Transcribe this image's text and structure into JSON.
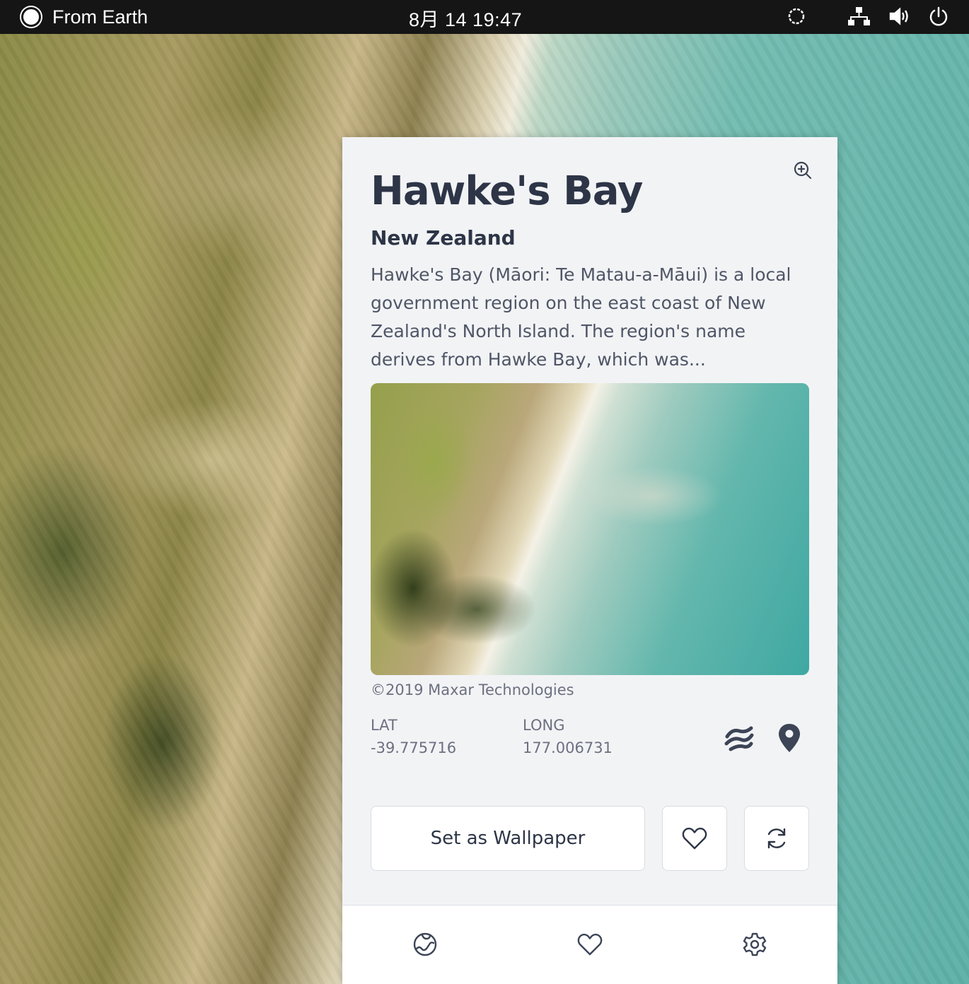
{
  "topbar": {
    "app_name": "From Earth",
    "clock": "8月 14  19:47",
    "icons": [
      "app-indicator-icon",
      "circle-status-icon",
      "network-icon",
      "volume-icon",
      "power-icon"
    ]
  },
  "location": {
    "name": "Hawke's Bay",
    "country": "New Zealand",
    "description": "Hawke's Bay (Māori: Te Matau-a-Māui) is a local government region on the east coast of New Zealand's North Island. The region's name derives from Hawke Bay, which was...",
    "credit": "©2019 Maxar Technologies",
    "lat_label": "LAT",
    "lat_value": "-39.775716",
    "long_label": "LONG",
    "long_value": "177.006731"
  },
  "actions": {
    "set_wallpaper": "Set as Wallpaper",
    "favorite_icon": "heart-icon",
    "refresh_icon": "refresh-icon",
    "zoom_icon": "zoom-in-icon",
    "earth_icon": "google-earth-icon",
    "maps_icon": "map-pin-icon"
  },
  "nav": {
    "items": [
      "globe-icon",
      "heart-icon",
      "gear-icon"
    ]
  },
  "colors": {
    "topbar_bg": "#151515",
    "panel_bg": "#f2f3f5",
    "title_text": "#2d3547",
    "muted_text": "#6c7080",
    "icon_color": "#3c4456"
  }
}
